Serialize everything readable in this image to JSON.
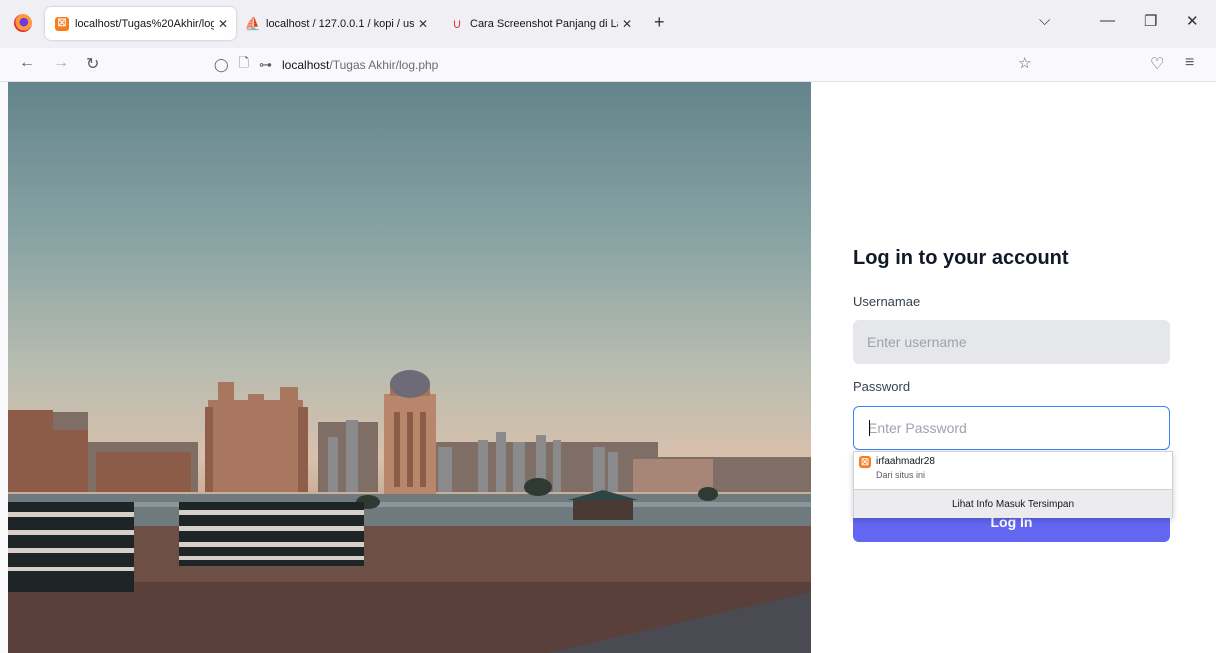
{
  "browser": {
    "tabs": [
      {
        "label": "localhost/Tugas%20Akhir/log.p",
        "icon": "xampp-icon",
        "active": true
      },
      {
        "label": "localhost / 127.0.0.1 / kopi / use",
        "icon": "phpmyadmin-icon",
        "active": false
      },
      {
        "label": "Cara Screenshot Panjang di Lap",
        "icon": "magnet-icon",
        "active": false
      }
    ],
    "url_host": "localhost",
    "url_path": "/Tugas Akhir/log.php"
  },
  "login": {
    "heading": "Log in to your account",
    "username_label": "Usernamae",
    "username_placeholder": "Enter username",
    "password_label": "Password",
    "password_placeholder": "Enter Password",
    "button": "Log In"
  },
  "autocomplete": {
    "username": "irfaahmadr28",
    "subtitle": "Dari situs ini",
    "footer": "Lihat Info Masuk Tersimpan"
  },
  "colors": {
    "accent": "#6366f1",
    "focus_border": "#3b82f6",
    "input_bg": "#e5e7eb"
  }
}
